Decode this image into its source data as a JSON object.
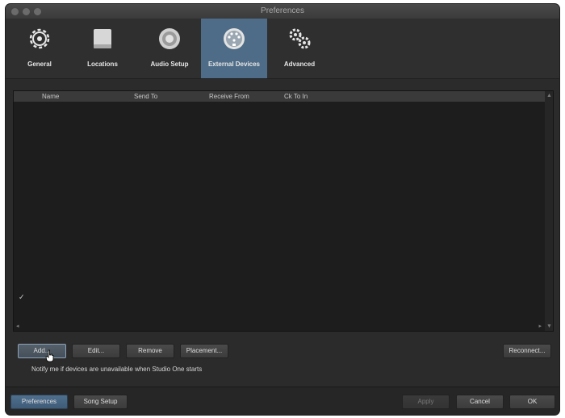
{
  "window": {
    "title": "Preferences"
  },
  "toolbar": {
    "items": [
      {
        "label": "General",
        "icon": "gear-icon"
      },
      {
        "label": "Locations",
        "icon": "drive-icon"
      },
      {
        "label": "Audio Setup",
        "icon": "speaker-icon"
      },
      {
        "label": "External Devices",
        "icon": "midi-port-icon",
        "active": true
      },
      {
        "label": "Advanced",
        "icon": "gears-icon"
      }
    ]
  },
  "table": {
    "columns": [
      "Name",
      "Send To",
      "Receive From",
      "Ck To In"
    ]
  },
  "actions": {
    "add": "Add...",
    "edit": "Edit...",
    "remove": "Remove",
    "placement": "Placement...",
    "reconnect": "Reconnect..."
  },
  "notify": {
    "label": "Notify me if devices are unavailable when Studio One starts",
    "checked": true
  },
  "footer": {
    "preferences": "Preferences",
    "song_setup": "Song Setup",
    "apply": "Apply",
    "cancel": "Cancel",
    "ok": "OK"
  },
  "colors": {
    "accent": "#4e6c87",
    "background": "#2b2b2b"
  }
}
